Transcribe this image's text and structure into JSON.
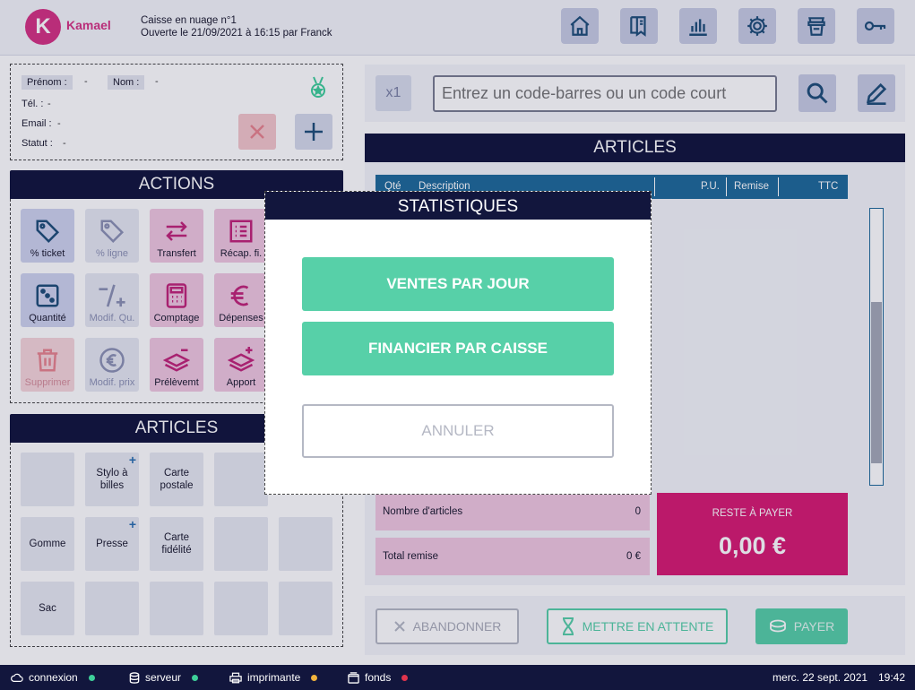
{
  "header": {
    "logo_letter": "K",
    "logo_text": "Kamael",
    "caisse_name": "Caisse en nuage n°1",
    "caisse_opened": "Ouverte le 21/09/2021 à 16:15 par Franck"
  },
  "customer": {
    "prenom_label": "Prénom :",
    "prenom_value": "-",
    "nom_label": "Nom :",
    "nom_value": "-",
    "tel_label": "Tél. :",
    "tel_value": "-",
    "email_label": "Email :",
    "email_value": "-",
    "statut_label": "Statut :",
    "statut_value": "-"
  },
  "actions": {
    "title": "ACTIONS",
    "items": [
      {
        "label": "% ticket"
      },
      {
        "label": "% ligne"
      },
      {
        "label": "Transfert"
      },
      {
        "label": "Récap. fi."
      },
      {
        "label": "Quantité"
      },
      {
        "label": "Modif. Qu."
      },
      {
        "label": "Comptage"
      },
      {
        "label": "Dépenses"
      },
      {
        "label": "Supprimer"
      },
      {
        "label": "Modif. prix"
      },
      {
        "label": "Prélèvemt"
      },
      {
        "label": "Apport"
      }
    ]
  },
  "articles_grid": {
    "title": "ARTICLES",
    "items": [
      {
        "label": ""
      },
      {
        "label": "Stylo à billes"
      },
      {
        "label": "Carte postale"
      },
      {
        "label": ""
      },
      {
        "label": "Gomme"
      },
      {
        "label": "Presse"
      },
      {
        "label": "Carte fidélité"
      },
      {
        "label": ""
      },
      {
        "label": ""
      },
      {
        "label": "Sac"
      },
      {
        "label": ""
      },
      {
        "label": ""
      },
      {
        "label": ""
      },
      {
        "label": ""
      }
    ]
  },
  "search": {
    "qty": "x1",
    "placeholder": "Entrez un code-barres ou un code court"
  },
  "cart": {
    "title": "ARTICLES",
    "columns": [
      "Qté",
      "Description",
      "P.U.",
      "Remise",
      "TTC"
    ],
    "nb_articles_label": "Nombre d'articles",
    "nb_articles_value": "0",
    "total_remise_label": "Total remise",
    "total_remise_value": "0 €",
    "reste_label": "RESTE À PAYER",
    "reste_value": "0,00 €"
  },
  "bottom": {
    "abandon": "ABANDONNER",
    "attente": "METTRE EN ATTENTE",
    "payer": "PAYER"
  },
  "modal": {
    "title": "STATISTIQUES",
    "btn_ventes": "VENTES PAR JOUR",
    "btn_financier": "FINANCIER PAR CAISSE",
    "btn_annuler": "ANNULER"
  },
  "status": {
    "connexion": "connexion",
    "serveur": "serveur",
    "imprimante": "imprimante",
    "fonds": "fonds",
    "date": "merc. 22 sept. 2021",
    "time": "19:42",
    "colors": {
      "ok": "#3ecf9a",
      "warn": "#f2b33d",
      "err": "#e0344d"
    }
  },
  "colors": {
    "navy": "#12163d",
    "pink": "#d81b73",
    "green": "#57d0a8",
    "blue": "#1f6b9a"
  }
}
